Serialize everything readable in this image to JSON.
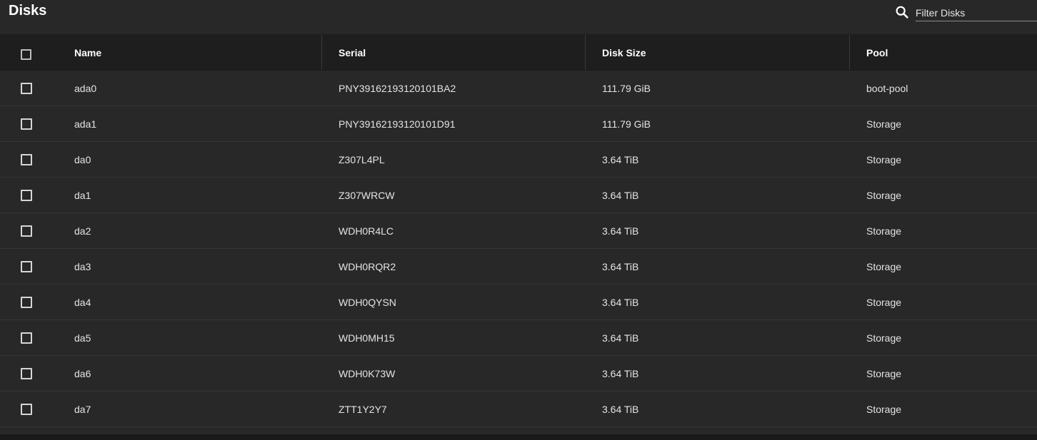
{
  "header": {
    "title": "Disks",
    "search_icon": "search-icon",
    "filter_placeholder": "Filter Disks"
  },
  "table": {
    "columns": [
      "Name",
      "Serial",
      "Disk Size",
      "Pool"
    ],
    "rows": [
      {
        "name": "ada0",
        "serial": "PNY39162193120101BA2",
        "size": "111.79 GiB",
        "pool": "boot-pool"
      },
      {
        "name": "ada1",
        "serial": "PNY39162193120101D91",
        "size": "111.79 GiB",
        "pool": "Storage"
      },
      {
        "name": "da0",
        "serial": "Z307L4PL",
        "size": "3.64 TiB",
        "pool": "Storage"
      },
      {
        "name": "da1",
        "serial": "Z307WRCW",
        "size": "3.64 TiB",
        "pool": "Storage"
      },
      {
        "name": "da2",
        "serial": "WDH0R4LC",
        "size": "3.64 TiB",
        "pool": "Storage"
      },
      {
        "name": "da3",
        "serial": "WDH0RQR2",
        "size": "3.64 TiB",
        "pool": "Storage"
      },
      {
        "name": "da4",
        "serial": "WDH0QYSN",
        "size": "3.64 TiB",
        "pool": "Storage"
      },
      {
        "name": "da5",
        "serial": "WDH0MH15",
        "size": "3.64 TiB",
        "pool": "Storage"
      },
      {
        "name": "da6",
        "serial": "WDH0K73W",
        "size": "3.64 TiB",
        "pool": "Storage"
      },
      {
        "name": "da7",
        "serial": "ZTT1Y2Y7",
        "size": "3.64 TiB",
        "pool": "Storage"
      }
    ]
  },
  "colors": {
    "background": "#282828",
    "header_row": "#1e1e1e",
    "text": "#ffffff"
  }
}
